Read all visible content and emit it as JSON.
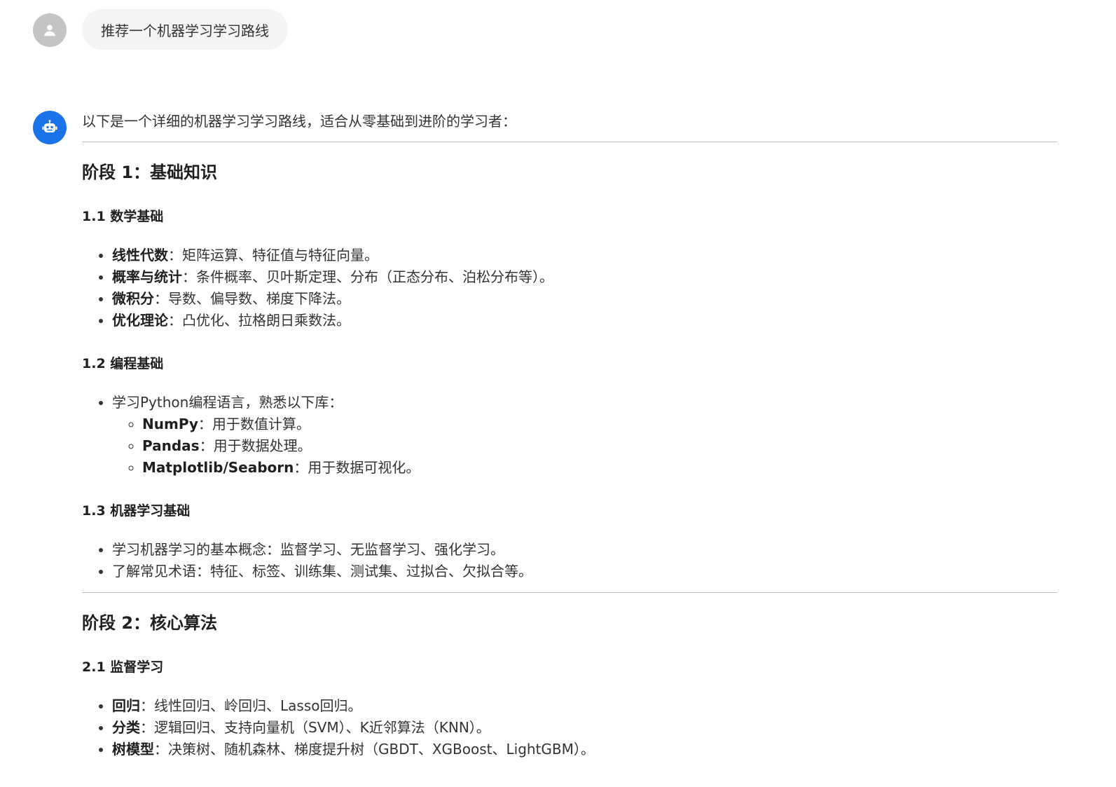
{
  "user_message": "推荐一个机器学习学习路线",
  "intro": "以下是一个详细的机器学习学习路线，适合从零基础到进阶的学习者：",
  "stage1": {
    "title": "阶段 1：基础知识",
    "s1": {
      "title": "1.1 数学基础",
      "items": [
        {
          "term": "线性代数",
          "desc": "：矩阵运算、特征值与特征向量。"
        },
        {
          "term": "概率与统计",
          "desc": "：条件概率、贝叶斯定理、分布（正态分布、泊松分布等）。"
        },
        {
          "term": "微积分",
          "desc": "：导数、偏导数、梯度下降法。"
        },
        {
          "term": "优化理论",
          "desc": "：凸优化、拉格朗日乘数法。"
        }
      ]
    },
    "s2": {
      "title": "1.2 编程基础",
      "item": "学习Python编程语言，熟悉以下库：",
      "libs": [
        {
          "term": "NumPy",
          "desc": "：用于数值计算。"
        },
        {
          "term": "Pandas",
          "desc": "：用于数据处理。"
        },
        {
          "term": "Matplotlib/Seaborn",
          "desc": "：用于数据可视化。"
        }
      ]
    },
    "s3": {
      "title": "1.3 机器学习基础",
      "items": [
        "学习机器学习的基本概念：监督学习、无监督学习、强化学习。",
        "了解常见术语：特征、标签、训练集、测试集、过拟合、欠拟合等。"
      ]
    }
  },
  "stage2": {
    "title": "阶段 2：核心算法",
    "s1": {
      "title": "2.1 监督学习",
      "items": [
        {
          "term": "回归",
          "desc": "：线性回归、岭回归、Lasso回归。"
        },
        {
          "term": "分类",
          "desc": "：逻辑回归、支持向量机（SVM）、K近邻算法（KNN）。"
        },
        {
          "term": "树模型",
          "desc": "：决策树、随机森林、梯度提升树（GBDT、XGBoost、LightGBM）。"
        }
      ]
    }
  },
  "icons": {
    "user_avatar": "person-icon",
    "bot_avatar": "robot-icon"
  },
  "colors": {
    "bot_avatar_bg": "#1a73e8",
    "user_avatar_bg": "#c4c4c4",
    "bubble_bg": "#f4f4f4"
  }
}
